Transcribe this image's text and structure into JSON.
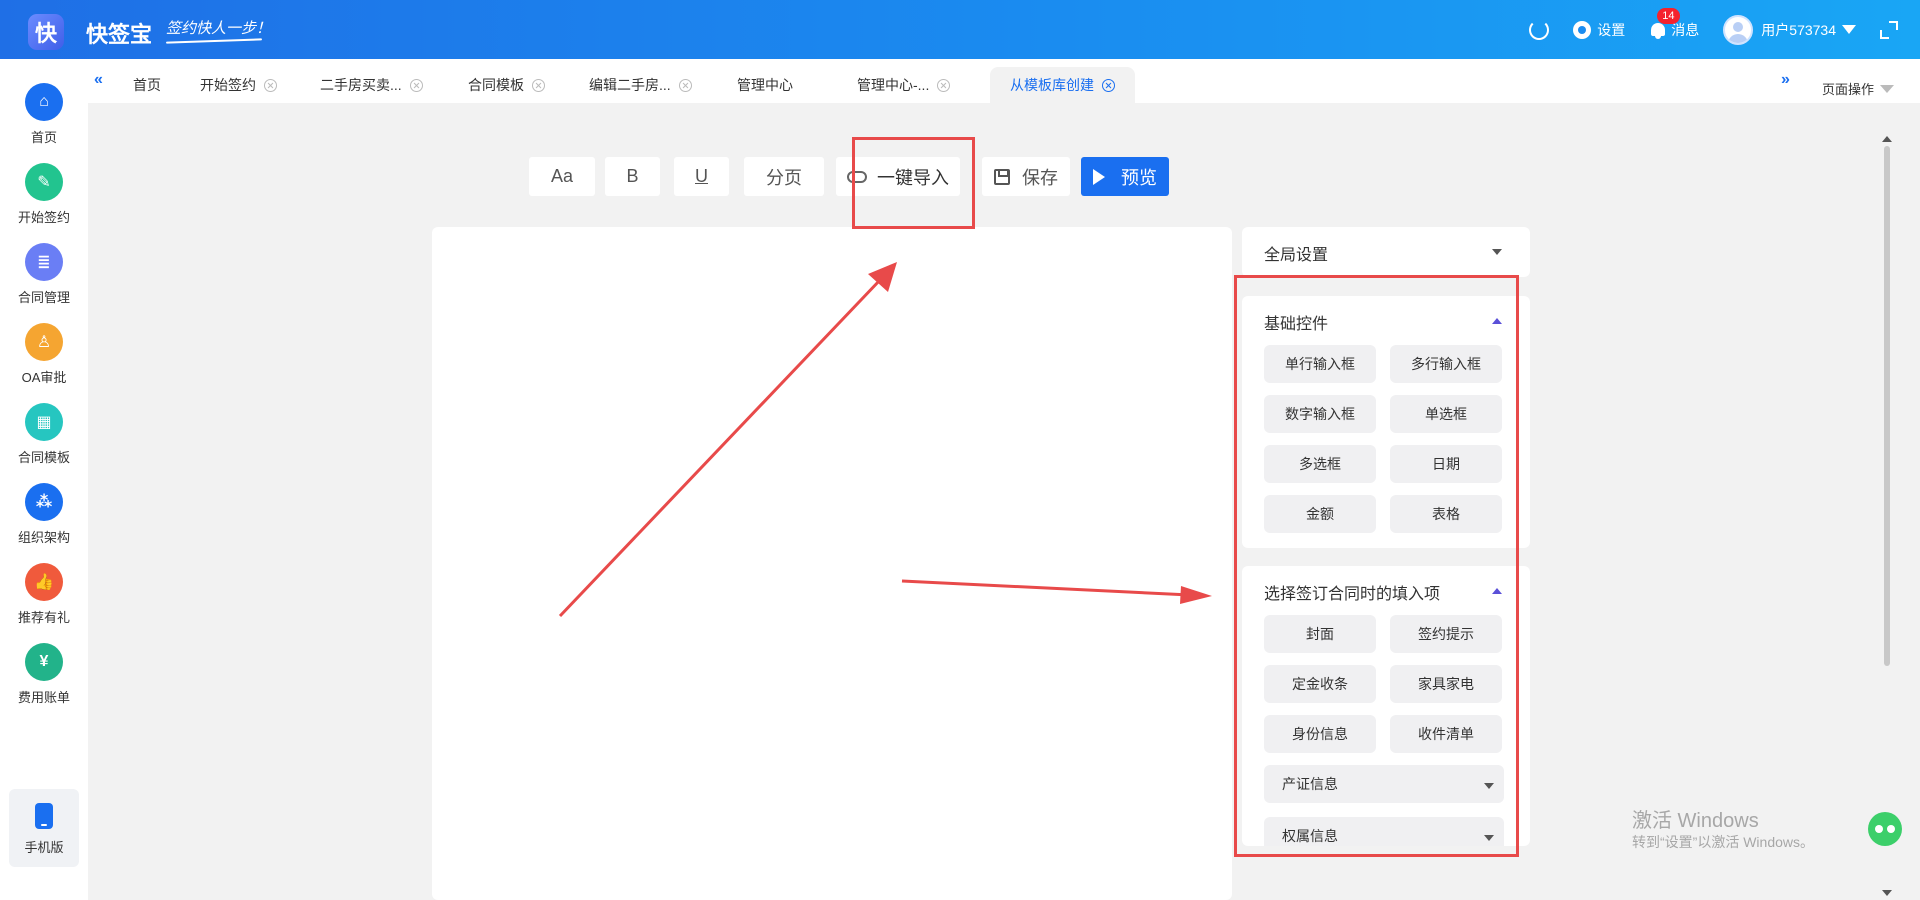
{
  "header": {
    "logo_char": "快",
    "app_name": "快签宝",
    "slogan": "签约快人一步！",
    "settings_label": "设置",
    "messages_label": "消息",
    "messages_badge": "14",
    "username": "用户573734"
  },
  "sidebar": {
    "items": [
      {
        "label": "首页",
        "icon": "home-icon",
        "color": "#1a6ff0",
        "glyph": "⌂"
      },
      {
        "label": "开始签约",
        "icon": "sign-icon",
        "color": "#22c48f",
        "glyph": "✎"
      },
      {
        "label": "合同管理",
        "icon": "contract-icon",
        "color": "#6a7ef5",
        "glyph": "≣"
      },
      {
        "label": "OA审批",
        "icon": "stamp-icon",
        "color": "#f5a531",
        "glyph": "♙"
      },
      {
        "label": "合同模板",
        "icon": "template-icon",
        "color": "#26c6c0",
        "glyph": "▦"
      },
      {
        "label": "组织架构",
        "icon": "org-icon",
        "color": "#1a6ff0",
        "glyph": "⁂"
      },
      {
        "label": "推荐有礼",
        "icon": "thumb-icon",
        "color": "#f05a3c",
        "glyph": "👍"
      },
      {
        "label": "费用账单",
        "icon": "bill-icon",
        "color": "#22b38a",
        "glyph": "¥"
      }
    ],
    "mobile_label": "手机版"
  },
  "tabs": {
    "items": [
      {
        "label": "首页",
        "closable": false,
        "active": false
      },
      {
        "label": "开始签约",
        "closable": true,
        "active": false
      },
      {
        "label": "二手房买卖...",
        "closable": true,
        "active": false
      },
      {
        "label": "合同模板",
        "closable": true,
        "active": false
      },
      {
        "label": "编辑二手房...",
        "closable": true,
        "active": false
      },
      {
        "label": "管理中心",
        "closable": false,
        "active": false
      },
      {
        "label": "管理中心-...",
        "closable": true,
        "active": false
      },
      {
        "label": "从模板库创建",
        "closable": true,
        "active": true
      }
    ],
    "page_ops_label": "页面操作"
  },
  "toolbar": {
    "font_label": "Aa",
    "bold_label": "B",
    "underline_label": "U",
    "pagebreak_label": "分页",
    "import_label": "一键导入",
    "save_label": "保存",
    "preview_label": "预览"
  },
  "panel": {
    "global_title": "全局设置",
    "basic_title": "基础控件",
    "basic_controls": [
      "单行输入框",
      "多行输入框",
      "数字输入框",
      "单选框",
      "多选框",
      "日期",
      "金额",
      "表格"
    ],
    "fill_title": "选择签订合同时的填入项",
    "fill_controls": [
      "封面",
      "签约提示",
      "定金收条",
      "家具家电",
      "身份信息",
      "收件清单"
    ],
    "fill_groups": [
      "产证信息",
      "权属信息"
    ]
  },
  "watermark": {
    "line1": "激活 Windows",
    "line2": "转到“设置”以激活 Windows。"
  },
  "colors": {
    "accent": "#1a6ff0",
    "annotation": "#e84a4a"
  }
}
